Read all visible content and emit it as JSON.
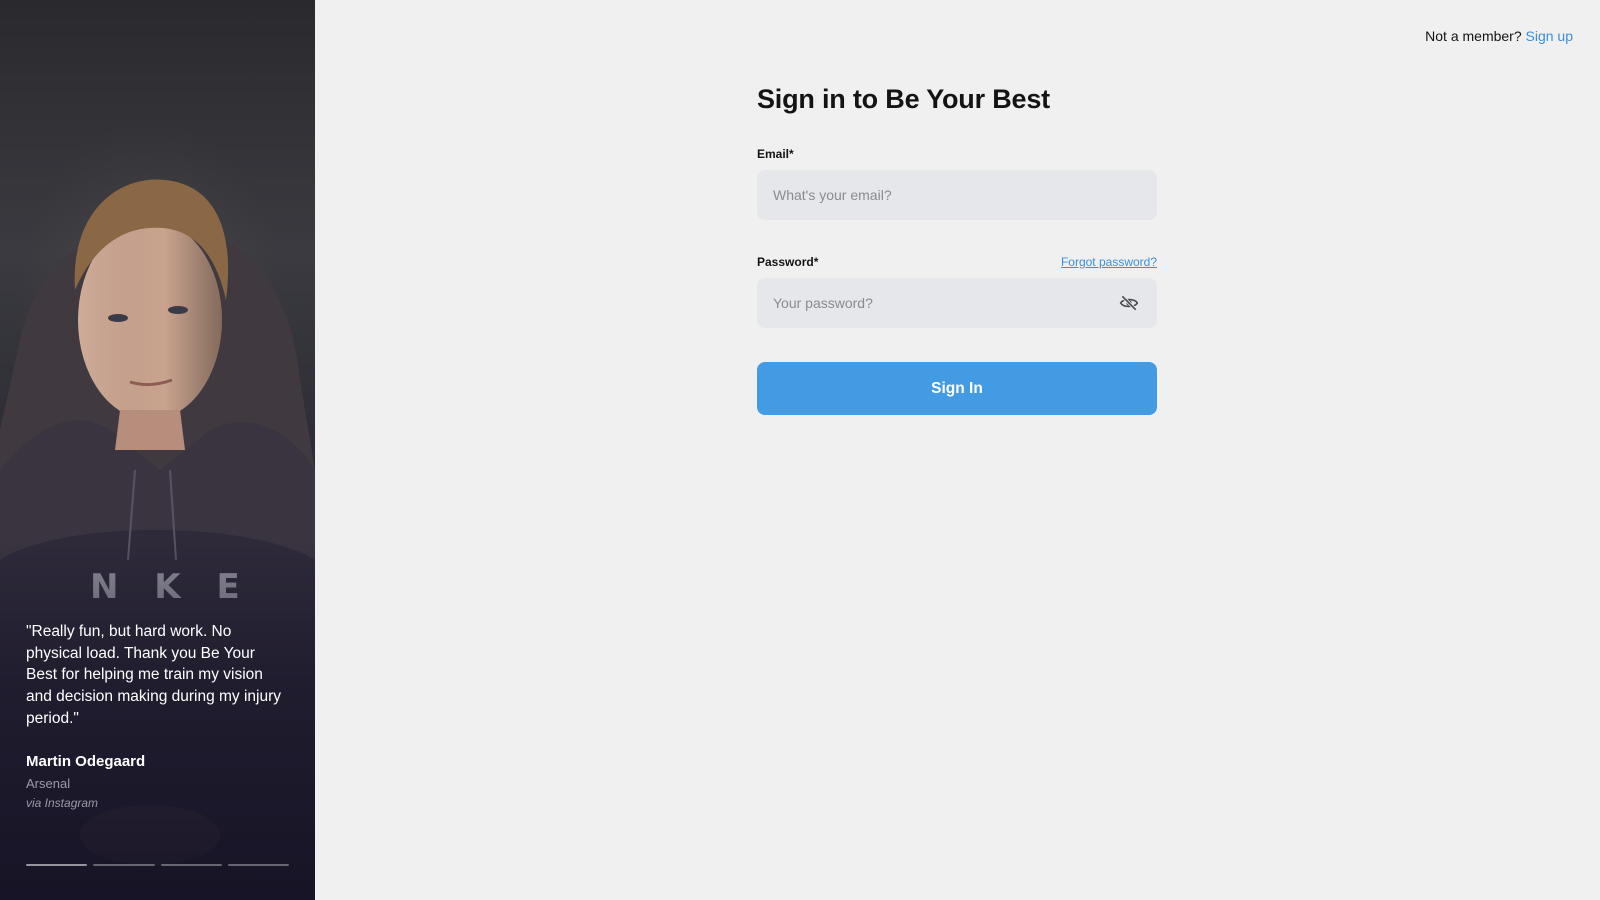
{
  "testimonial": {
    "quote": "\"Really fun, but hard work. No physical load. Thank you Be Your Best for helping me train my vision and decision making during my injury period.\"",
    "author": "Martin Odegaard",
    "club": "Arsenal",
    "source": "via Instagram",
    "photo_icon": "athlete-portrait",
    "slide_count": 4,
    "active_slide": 1
  },
  "header": {
    "prompt": "Not a member?",
    "signup_label": "Sign up"
  },
  "form": {
    "title": "Sign in to Be Your Best",
    "email": {
      "label": "Email*",
      "placeholder": "What's your email?",
      "value": ""
    },
    "password": {
      "label": "Password*",
      "placeholder": "Your password?",
      "value": "",
      "forgot_label": "Forgot password?",
      "toggle_icon": "eye-off-icon"
    },
    "submit_label": "Sign In"
  },
  "colors": {
    "accent": "#439be3",
    "link": "#3b8fd9",
    "background": "#f0f0f1",
    "input_bg": "#e6e7ea"
  }
}
